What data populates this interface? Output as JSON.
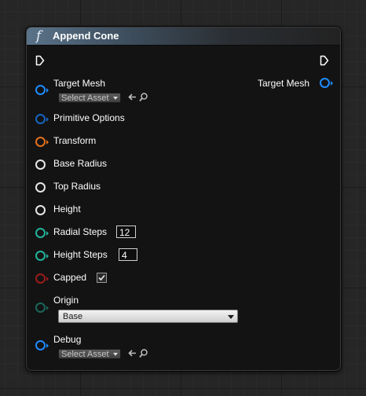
{
  "node": {
    "title": "Append Cone",
    "function_icon": "f"
  },
  "pins": {
    "target_mesh_label": "Target Mesh",
    "target_mesh_asset": "Select Asset",
    "output_target_mesh_label": "Target Mesh",
    "primitive_options_label": "Primitive Options",
    "transform_label": "Transform",
    "base_radius_label": "Base Radius",
    "top_radius_label": "Top Radius",
    "height_label": "Height",
    "radial_steps_label": "Radial Steps",
    "radial_steps_value": "12",
    "height_steps_label": "Height Steps",
    "height_steps_value": "4",
    "capped_label": "Capped",
    "capped_checked": true,
    "origin_label": "Origin",
    "origin_value": "Base",
    "debug_label": "Debug",
    "debug_asset": "Select Asset"
  },
  "colors": {
    "object_pin": "#1e8bff",
    "struct_pin": "#1565c0",
    "transform_pin": "#e0701c",
    "float_pin": "#e6e6e6",
    "int_pin": "#22b39b",
    "bool_pin": "#9b1b1b",
    "enum_pin": "#1c6659",
    "header_accent": "#5a7389"
  },
  "icons": [
    "function-icon",
    "exec-pin-icon",
    "use-asset-arrow-icon",
    "browse-magnifier-icon",
    "check-icon",
    "chevron-down-icon"
  ]
}
